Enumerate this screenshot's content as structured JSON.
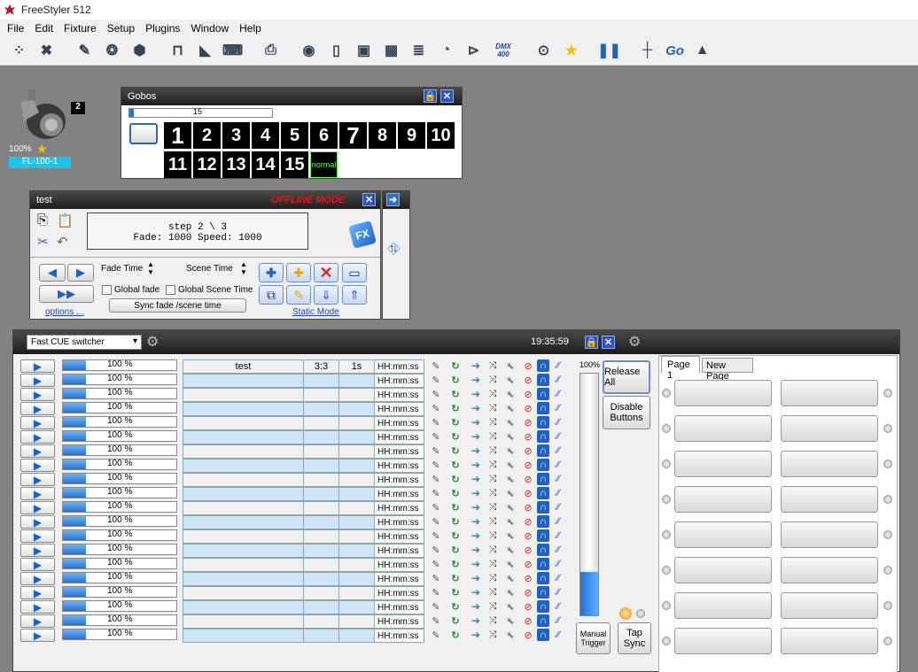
{
  "app": {
    "title": "FreeStyler 512"
  },
  "menu": [
    "File",
    "Edit",
    "Fixture",
    "Setup",
    "Plugins",
    "Window",
    "Help"
  ],
  "toolbar": {
    "icons": [
      "fixtures-icon",
      "fixture-select-icon",
      "wand-icon",
      "gobo-wheel-icon",
      "shutter-icon",
      "truss-icon",
      "ramp-icon",
      "keyboard-icon",
      "printer-icon",
      "3d-icon",
      "new-doc-icon",
      "cue-icon",
      "submaster-icon",
      "mixer-icon",
      "speaker-icon",
      "horn-icon",
      "dmx-icon",
      "mouse-icon",
      "star-icon",
      "pause-icon",
      "fader-icon",
      "go-icon",
      "blackout-icon"
    ],
    "dmx_label": "DMX 400",
    "go_label": "Go"
  },
  "fixture": {
    "number": "2",
    "percent": "100%",
    "name": "FL-100-1"
  },
  "gobos": {
    "title": "Gobos",
    "slider_value": "15",
    "slider_level": 0.03,
    "items": [
      "1",
      "2",
      "3",
      "4",
      "5",
      "6",
      "7",
      "8",
      "9",
      "10",
      "11",
      "12",
      "13",
      "14",
      "15",
      "normal"
    ]
  },
  "test": {
    "title": "test",
    "offline": "OFFLINE MODE",
    "display_line1": "step 2 \\ 3",
    "display_line2": "Fade: 1000  Speed: 1000",
    "fx_label": "FX",
    "fade_time": "Fade Time",
    "scene_time": "Scene Time",
    "global_fade": "Global fade",
    "global_scene": "Global Scene Time",
    "sync": "Sync fade /scene time",
    "options": "options ...",
    "static_mode": "Static Mode"
  },
  "cue": {
    "switcher": "Fast CUE switcher",
    "clock": "19:35:59",
    "release": "Release All",
    "disable": "Disable Buttons",
    "master_pct": "100%",
    "master_level": 0.18,
    "manual": "Manual Trigger",
    "tap": "Tap Sync",
    "pages": [
      "Page 1",
      "New Page"
    ],
    "row_pct": "100 %",
    "row_level": 0.2,
    "time_placeholder": "HH:mm:ss",
    "first_row": {
      "name": "test",
      "step": "3:3",
      "fade": "1s"
    }
  }
}
